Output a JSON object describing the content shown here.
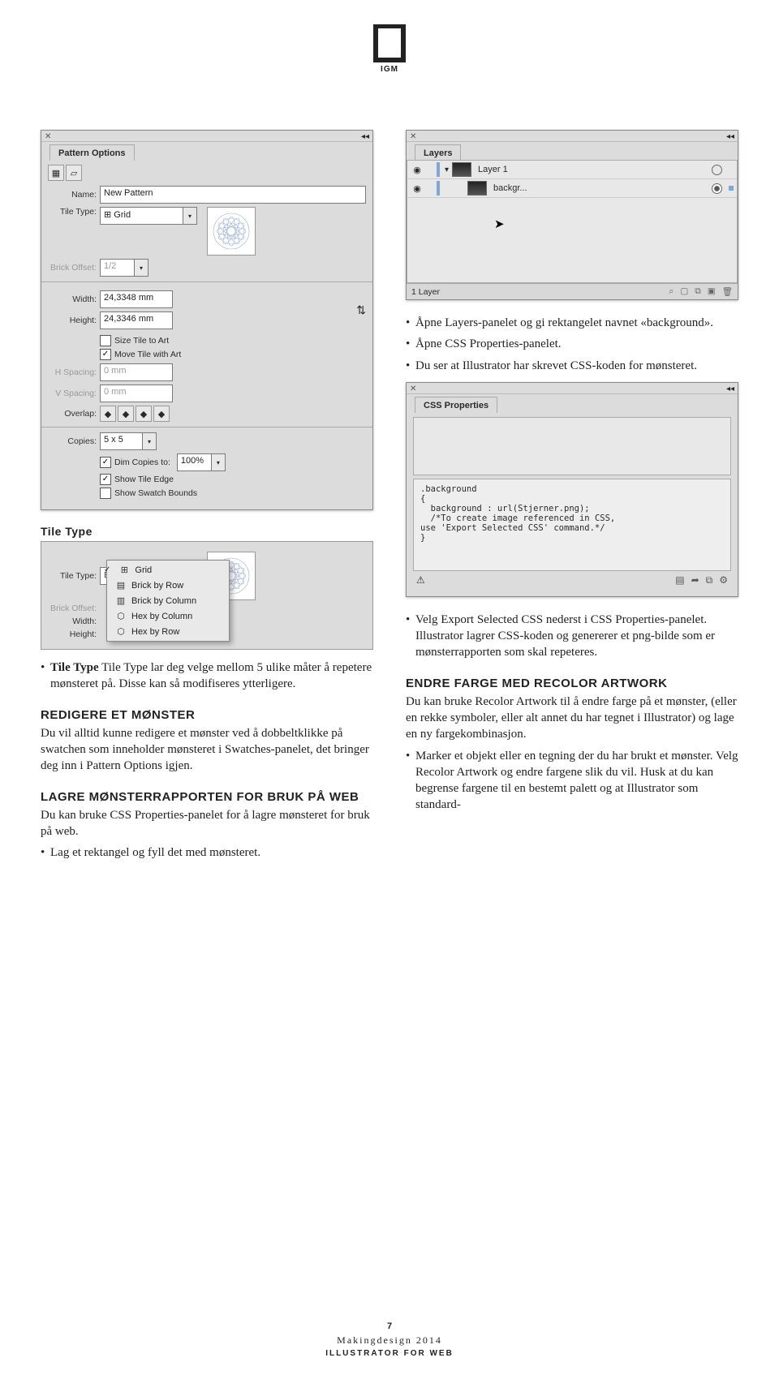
{
  "logo_label": "IGM",
  "pattern_panel": {
    "title": "Pattern Options",
    "name_label": "Name:",
    "name_value": "New Pattern",
    "tile_type_label": "Tile Type:",
    "tile_type_value": "Grid",
    "tile_type_glyph": "⊞",
    "brick_offset_label": "Brick Offset:",
    "brick_offset_value": "1/2",
    "width_label": "Width:",
    "width_value": "24,3348 mm",
    "height_label": "Height:",
    "height_value": "24,3346 mm",
    "link_glyph": "⇅",
    "size_to_art_label": "Size Tile to Art",
    "move_with_art_label": "Move Tile with Art",
    "hspacing_label": "H Spacing:",
    "hspacing_value": "0 mm",
    "vspacing_label": "V Spacing:",
    "vspacing_value": "0 mm",
    "overlap_label": "Overlap:",
    "copies_label": "Copies:",
    "copies_value": "5 x 5",
    "dim_label": "Dim Copies to:",
    "dim_value": "100%",
    "show_tile_edge_label": "Show Tile Edge",
    "show_swatch_bounds_label": "Show Swatch Bounds"
  },
  "tile_type_section": {
    "heading": "Tile Type",
    "tile_type_label": "Tile Type:",
    "tile_type_value": "Grid",
    "brick_offset_label": "Brick Offset:",
    "width_label": "Width:",
    "height_label": "Height:",
    "menu": [
      "Grid",
      "Brick by Row",
      "Brick by Column",
      "Hex by Column",
      "Hex by Row"
    ],
    "para1": "Tile Type lar deg velge mellom 5 ulike måter å repetere mønsteret på. Disse kan så modifiseres ytterligere."
  },
  "redigere": {
    "heading": "REDIGERE ET MØNSTER",
    "body": "Du vil alltid kunne redigere et mønster ved å dobbeltklikke på swatchen som inneholder mønsteret i Swatches-panelet, det bringer deg inn i Pattern Options igjen."
  },
  "lagre": {
    "heading": "LAGRE MØNSTERRAPPORTEN FOR BRUK PÅ WEB",
    "body": "Du kan bruke CSS Properties-panelet for å lagre mønsteret for bruk på web.",
    "bullet": "Lag et rektangel og fyll det med mønsteret."
  },
  "layers_panel": {
    "title": "Layers",
    "rows": [
      {
        "name": "Layer 1",
        "indent": 0,
        "selected": false
      },
      {
        "name": "backgr...",
        "indent": 1,
        "selected": true
      }
    ],
    "footer": "1 Layer"
  },
  "intro_bullets": [
    "Åpne Layers-panelet og gi rektangelet navnet «background».",
    "Åpne CSS Properties-panelet.",
    "Du ser at Illustrator har skrevet CSS-koden for mønsteret."
  ],
  "css_panel": {
    "title": "CSS Properties",
    "code": ".background\n{\n  background : url(Stjerner.png);\n  /*To create image referenced in CSS,\nuse 'Export Selected CSS' command.*/\n}",
    "warn": "⚠"
  },
  "export_bullet": "Velg Export Selected CSS nederst i CSS Properties-panelet. Illustrator lagrer CSS-koden og genererer et png-bilde som er mønsterrapporten som skal repeteres.",
  "recolor": {
    "heading": "ENDRE FARGE MED RECOLOR ARTWORK",
    "body": "Du kan bruke Recolor Artwork til å endre farge på et mønster, (eller en rekke symboler, eller alt annet du har tegnet i Illustrator) og lage en ny fargekombinasjon.",
    "bullet": "Marker et objekt eller en tegning der du har brukt et mønster. Velg Recolor Artwork og endre fargene slik du vil. Husk at du kan begrense fargene til en bestemt palett og at Illustrator som standard-"
  },
  "footer": {
    "page": "7",
    "line1": "Makingdesign 2014",
    "line2": "ILLUSTRATOR FOR WEB"
  }
}
